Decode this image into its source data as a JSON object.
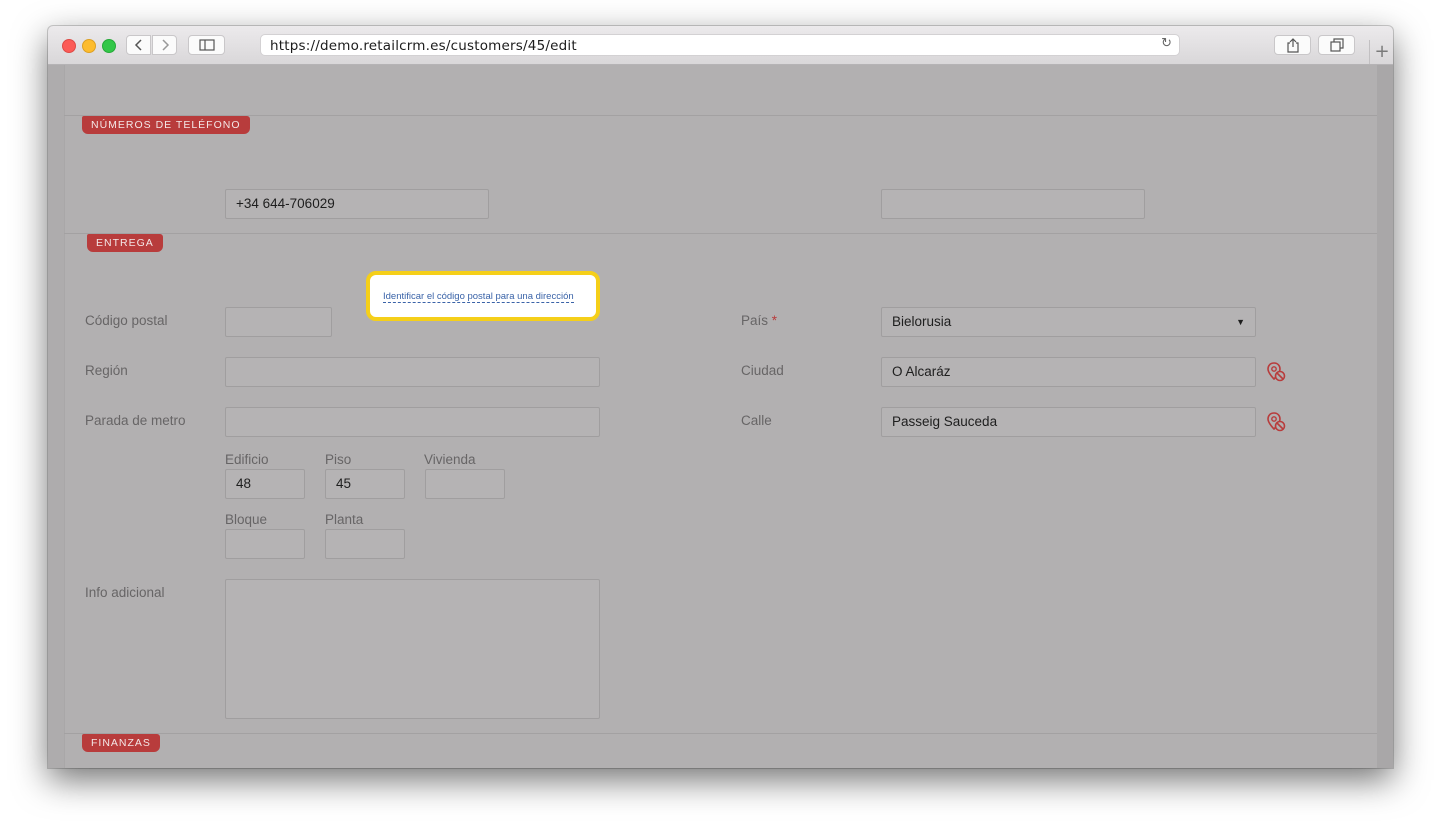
{
  "browser": {
    "url": "https://demo.retailcrm.es/customers/45/edit",
    "back_icon": "chevron-left-icon",
    "forward_icon": "chevron-right-icon",
    "sidebar_icon": "sidebar-icon",
    "reload_icon": "reload-icon",
    "share_icon": "share-icon",
    "tabs_icon": "tabs-icon",
    "new_tab_label": "+"
  },
  "sections": {
    "phones": {
      "title": "NÚMEROS DE TELÉFONO"
    },
    "delivery": {
      "title": "ENTREGA"
    },
    "finance": {
      "title": "FINANZAS"
    }
  },
  "phones": {
    "phone1": "+34 644-706029",
    "phone2": ""
  },
  "delivery": {
    "postal_code_label": "Código postal",
    "postal_code_value": "",
    "identify_link": "Identificar el código postal para una dirección",
    "region_label": "Región",
    "region_value": "",
    "metro_label": "Parada de metro",
    "metro_value": "",
    "building_label": "Edificio",
    "building_value": "48",
    "floor_label": "Piso",
    "floor_value": "45",
    "housing_label": "Vivienda",
    "housing_value": "",
    "block_label": "Bloque",
    "block_value": "",
    "storey_label": "Planta",
    "storey_value": "",
    "info_label": "Info adicional",
    "info_value": "",
    "country_label": "País",
    "country_required": "*",
    "country_value": "Bielorusia",
    "city_label": "Ciudad",
    "city_value": "O Alcaráz",
    "street_label": "Calle",
    "street_value": "Passeig Sauceda"
  },
  "colors": {
    "accent": "#b83c3c",
    "highlight_border": "#f5cf19",
    "link": "#3a63a8"
  }
}
